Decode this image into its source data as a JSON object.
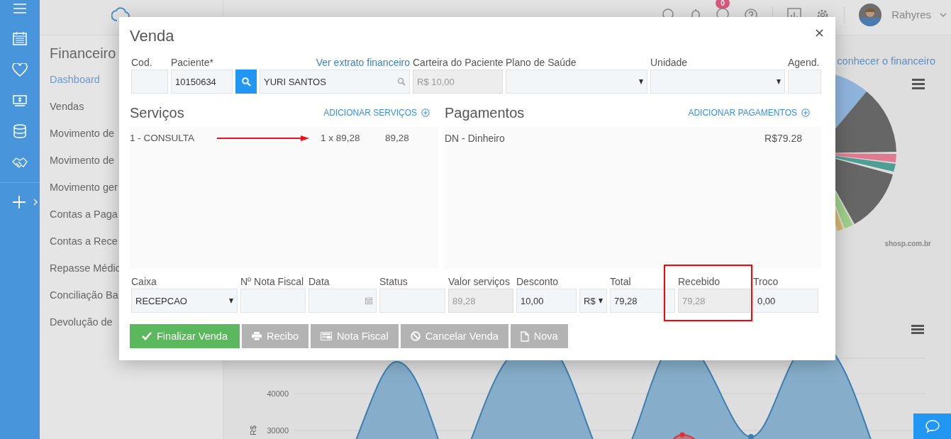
{
  "app": {
    "notification_count": "0",
    "user_name": "Rahyres"
  },
  "nav": {
    "title": "Financeiro",
    "items": [
      {
        "label": "Dashboard",
        "selected": true
      },
      {
        "label": "Vendas",
        "selected": false
      },
      {
        "label": "Movimento de",
        "selected": false
      },
      {
        "label": "Movimento de",
        "selected": false
      },
      {
        "label": "Movimento ger",
        "selected": false
      },
      {
        "label": "Contas a Paga",
        "selected": false
      },
      {
        "label": "Contas a Rece",
        "selected": false
      },
      {
        "label": "Repasse Médic",
        "selected": false
      },
      {
        "label": "Conciliação Ba",
        "selected": false
      },
      {
        "label": "Devolução de",
        "selected": false
      }
    ]
  },
  "dashboard": {
    "help_link": "conhecer o financeiro",
    "pie_credit": "shosp.com.br",
    "chart_ylabel": "R$",
    "chart_ticks": [
      "40000",
      "30000"
    ]
  },
  "modal": {
    "title": "Venda",
    "patient_fields": [
      {
        "kind": "text",
        "label": "Cod.",
        "disabled": false
      },
      {
        "kind": "text",
        "label": "Paciente*",
        "value": "10150634",
        "disabled": false
      },
      {
        "kind": "search_button"
      },
      {
        "kind": "search_text",
        "link": "Ver extrato financeiro",
        "value": "YURI SANTOS",
        "disabled": false
      },
      {
        "kind": "text",
        "label": "Carteira do Paciente",
        "value": "R$ 10,00",
        "disabled": true
      },
      {
        "kind": "select",
        "label": "Plano de Saúde",
        "disabled": false
      },
      {
        "kind": "select",
        "label": "Unidade",
        "disabled": false
      },
      {
        "kind": "text",
        "label": "Agend.",
        "disabled": false
      }
    ],
    "services": {
      "title": "Serviços",
      "add_label": "ADICIONAR SERVIÇOS",
      "items": [
        {
          "name": "1 - CONSULTA",
          "arrow": true,
          "quantity": "1 x 89,28",
          "total": "89,28"
        }
      ]
    },
    "payments": {
      "title": "Pagamentos",
      "add_label": "ADICIONAR PAGAMENTOS",
      "items": [
        {
          "name": "DN - Dinheiro",
          "amount": "R$79.28"
        }
      ]
    },
    "summary_fields": [
      {
        "kind": "select",
        "label": "Caixa",
        "value": "RECEPCAO",
        "disabled": false,
        "highlighted": false
      },
      {
        "kind": "text",
        "label": "Nº Nota Fiscal",
        "disabled": false,
        "highlighted": false
      },
      {
        "kind": "date",
        "label": "Data",
        "disabled": false,
        "highlighted": false
      },
      {
        "kind": "text",
        "label": "Status",
        "disabled": false,
        "highlighted": false
      },
      {
        "kind": "text",
        "label": "Valor serviços",
        "value": "89,28",
        "disabled": true,
        "highlighted": false
      },
      {
        "kind": "text",
        "label": "Desconto",
        "value": "10,00",
        "disabled": false,
        "highlighted": false
      },
      {
        "kind": "select",
        "value": "R$",
        "disabled": false,
        "highlighted": false
      },
      {
        "kind": "text",
        "label": "Total",
        "value": "79,28",
        "disabled": false,
        "highlighted": false
      },
      {
        "kind": "text",
        "label": "Recebido",
        "value": "79,28",
        "disabled": true,
        "highlighted": true
      },
      {
        "kind": "text",
        "label": "Troco",
        "value": "0,00",
        "disabled": false,
        "highlighted": false
      }
    ],
    "buttons": [
      {
        "label": "Finalizar Venda",
        "kind": "check",
        "primary": true
      },
      {
        "label": "Recibo",
        "kind": "print",
        "primary": false
      },
      {
        "label": "Nota Fiscal",
        "kind": "invoice",
        "primary": false
      },
      {
        "label": "Cancelar Venda",
        "kind": "cancel",
        "primary": false
      },
      {
        "label": "Nova",
        "kind": "file",
        "primary": false
      }
    ]
  }
}
